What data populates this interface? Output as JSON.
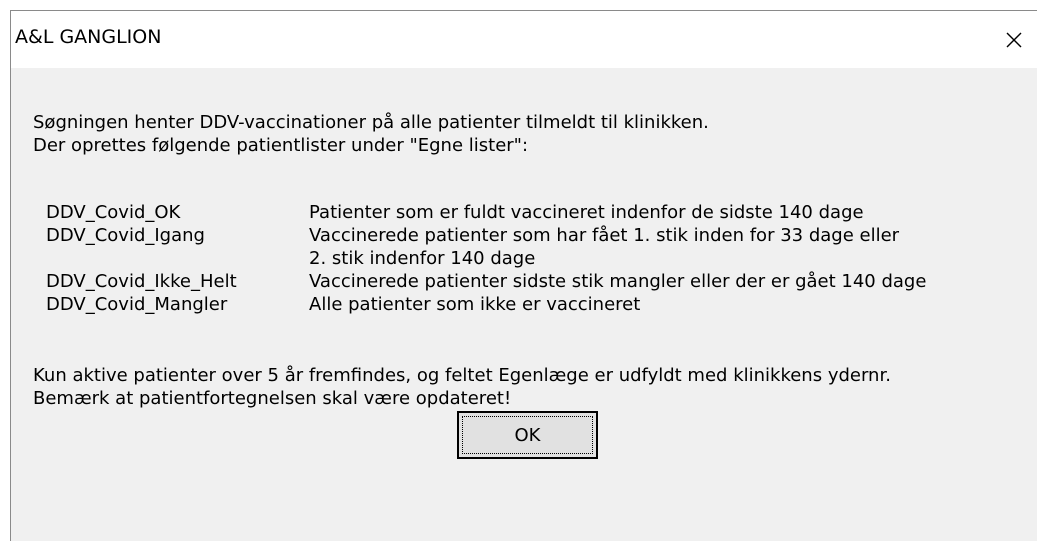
{
  "window": {
    "title": "A&L GANGLION",
    "close_icon": "close-icon"
  },
  "message": {
    "intro_line1": "Søgningen henter DDV-vaccinationer på alle patienter tilmeldt til klinikken.",
    "intro_line2": "Der oprettes følgende patientlister under \"Egne lister\":",
    "lists": [
      {
        "name": "DDV_Covid_OK",
        "desc": "Patienter som er fuldt vaccineret indenfor de sidste 140 dage"
      },
      {
        "name": "DDV_Covid_Igang",
        "desc": "Vaccinerede patienter som har fået 1. stik inden for 33 dage eller",
        "desc2": "2. stik indenfor 140 dage"
      },
      {
        "name": "DDV_Covid_Ikke_Helt",
        "desc": "Vaccinerede patienter sidste stik mangler eller der er gået 140 dage"
      },
      {
        "name": "DDV_Covid_Mangler",
        "desc": "Alle patienter som ikke er vaccineret"
      }
    ],
    "footer_line1": "Kun aktive patienter over 5 år fremfindes, og feltet Egenlæge er udfyldt med klinikkens ydernr.",
    "footer_line2": "Bemærk at patientfortegnelsen skal være opdateret!"
  },
  "buttons": {
    "ok_label": "OK"
  }
}
